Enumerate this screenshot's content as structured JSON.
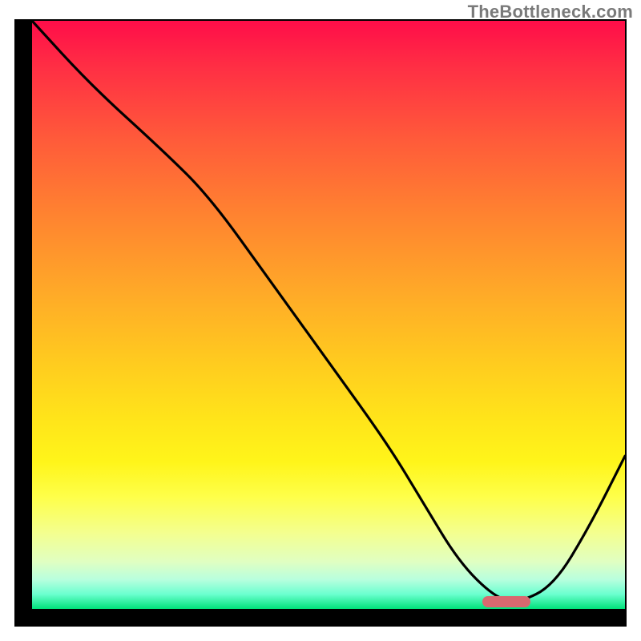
{
  "watermark": "TheBottleneck.com",
  "colors": {
    "axis": "#000000",
    "curve": "#000000",
    "marker": "#d9696f",
    "gradient_top": "#ff0d49",
    "gradient_bottom": "#00e17a"
  },
  "chart_data": {
    "type": "line",
    "title": "",
    "xlabel": "",
    "ylabel": "",
    "xlim": [
      0,
      100
    ],
    "ylim": [
      0,
      100
    ],
    "x": [
      0,
      10,
      22,
      30,
      40,
      50,
      60,
      66,
      72,
      78,
      82,
      88,
      94,
      100
    ],
    "values": [
      100,
      89,
      78,
      70,
      56,
      42,
      28,
      18,
      8,
      2,
      1,
      4,
      14,
      26
    ],
    "optimum_range_x": [
      76,
      84
    ],
    "annotations": []
  }
}
